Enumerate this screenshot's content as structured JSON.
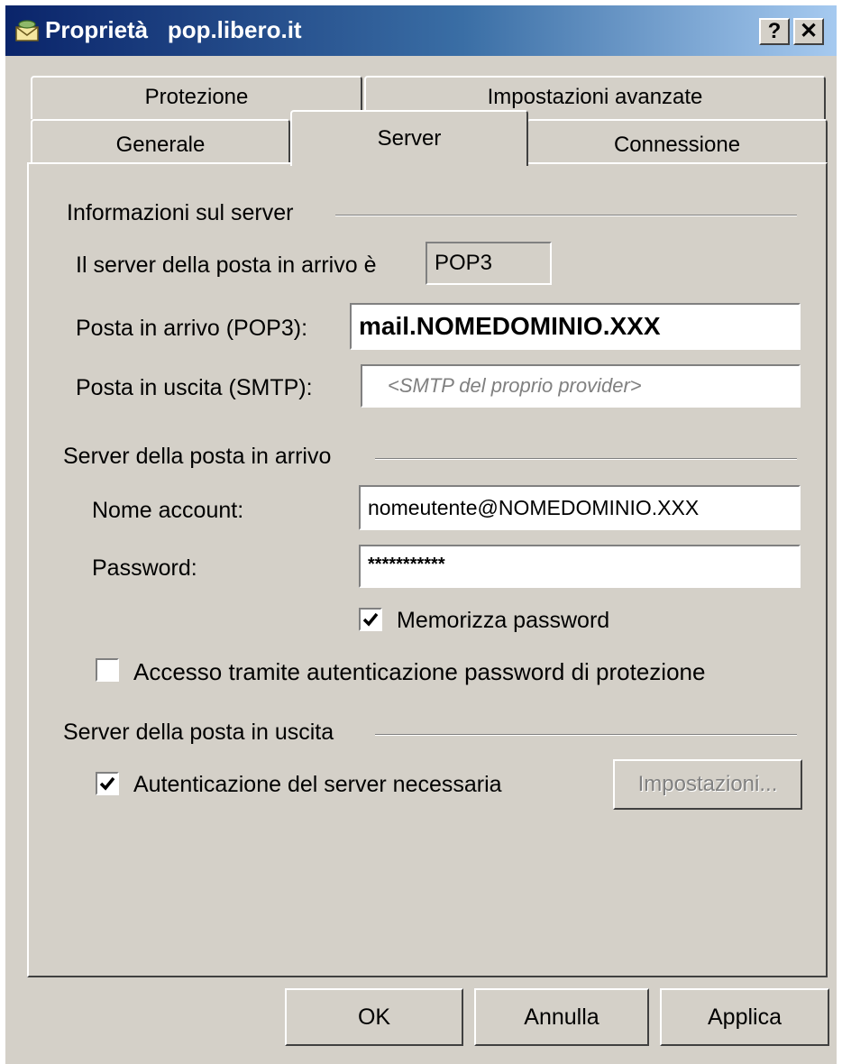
{
  "window": {
    "title": "Proprietà   pop.libero.it",
    "help_button": "?",
    "close_button": "✕"
  },
  "tabs": {
    "back_row": [
      "Protezione",
      "Impostazioni avanzate"
    ],
    "front_row": [
      "Generale",
      "Server",
      "Connessione"
    ],
    "active": "Server"
  },
  "server_info": {
    "section_title": "Informazioni sul server",
    "incoming_type_label": "Il server della posta in arrivo è",
    "incoming_type_value": "POP3",
    "incoming_label": "Posta in arrivo (POP3):",
    "incoming_value": "mail.NOMEDOMINIO.XXX",
    "outgoing_label": "Posta in uscita (SMTP):",
    "outgoing_value": "<SMTP del proprio provider>"
  },
  "incoming_server": {
    "section_title": "Server della posta in arrivo",
    "account_label": "Nome account:",
    "account_value": "nomeutente@NOMEDOMINIO.XXX",
    "password_label": "Password:",
    "password_value": "***********",
    "remember_label": "Memorizza password",
    "remember_checked": true,
    "spa_label": "Accesso tramite autenticazione password di protezione",
    "spa_checked": false
  },
  "outgoing_server": {
    "section_title": "Server della posta in uscita",
    "auth_label": "Autenticazione del server necessaria",
    "auth_checked": true,
    "settings_button": "Impostazioni..."
  },
  "footer": {
    "ok": "OK",
    "cancel": "Annulla",
    "apply": "Applica"
  }
}
